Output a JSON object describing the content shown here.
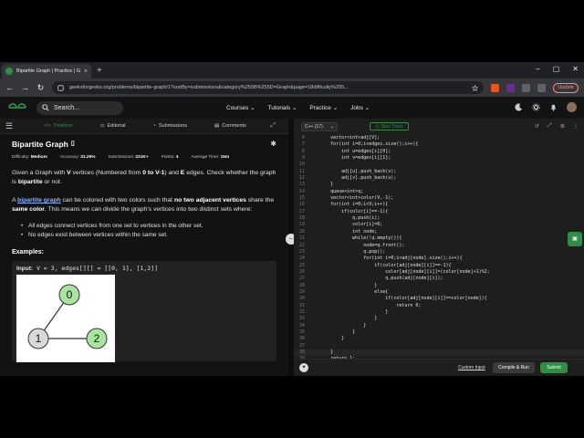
{
  "browser": {
    "tab_title": "Bipartite Graph | Practice | Geek",
    "tab_close": "×",
    "new_tab": "+",
    "url": "geeksforgeeks.org/problems/bipartite-graph/1?sortBy=submissions&category%255B%255D=Graph&page=18difficulty%255...",
    "update_label": "Update",
    "window_controls": [
      "–",
      "▢",
      "✕"
    ],
    "nav": [
      "←",
      "→",
      "↻"
    ]
  },
  "header": {
    "search_placeholder": "Search...",
    "menu": [
      "Courses ⌄",
      "Tutorials ⌄",
      "Practice ⌄",
      "Jobs ⌄"
    ]
  },
  "left_tabs": [
    {
      "icon": "</>",
      "label": "Problem"
    },
    {
      "icon": "▭",
      "label": "Editorial"
    },
    {
      "icon": "◔",
      "label": "Submissions"
    },
    {
      "icon": "▤",
      "label": "Comments"
    }
  ],
  "problem": {
    "title": "Bipartite Graph",
    "difficulty_label": "Difficulty:",
    "difficulty": "Medium",
    "accuracy_label": "Accuracy:",
    "accuracy": "31.25%",
    "submissions_label": "Submissions:",
    "submissions": "221K+",
    "points_label": "Points:",
    "points": "4",
    "avg_time_label": "Average Time:",
    "avg_time": "15m",
    "p1_a": "Given a Graph with ",
    "p1_b": "V",
    "p1_c": " vertices (Numbered from ",
    "p1_d": "0 to V-1",
    "p1_e": ") and ",
    "p1_f": "E",
    "p1_g": " edges. Check whether the graph is ",
    "p1_h": "bipartite",
    "p1_i": " or not.",
    "p2_a": "A ",
    "p2_link": "bipartite graph",
    "p2_b": " can be colored with two colors such that ",
    "p2_c": "no two adjacent vertices",
    "p2_d": " share the ",
    "p2_e": "same color",
    "p2_f": ". This means we can divide the graph's vertices into two distinct sets where:",
    "bullets": [
      "All edges connect vertices from one set to vertices in the other set.",
      "No edges exist between vertices within the same set."
    ],
    "examples_label": "Examples:",
    "example_input_label": "Input:",
    "example_input": " V = 3, edges[][] = [[0, 1], [1,2]]",
    "graph_nodes": [
      "0",
      "1",
      "2"
    ]
  },
  "editor": {
    "language": "C++ (17)",
    "timer_label": "Start Timer",
    "lines": [
      {
        "n": "6",
        "t": "        vector<int>adj[V];"
      },
      {
        "n": "7",
        "t": "        for(int i=0;i<edges.size();i++){"
      },
      {
        "n": "8",
        "t": "            int u=edges[i][0];"
      },
      {
        "n": "9",
        "t": "            int v=edges[i][1];"
      },
      {
        "n": "10",
        "t": ""
      },
      {
        "n": "11",
        "t": "            adj[u].push_back(v);"
      },
      {
        "n": "12",
        "t": "            adj[v].push_back(u);"
      },
      {
        "n": "13",
        "t": "        }"
      },
      {
        "n": "14",
        "t": "        queue<int>q;"
      },
      {
        "n": "15",
        "t": "        vector<int>color(V,-1);"
      },
      {
        "n": "16",
        "t": "        for(int i=0;i<V;i++){"
      },
      {
        "n": "17",
        "t": "            if(color[i]==-1){"
      },
      {
        "n": "18",
        "t": "                q.push(i);"
      },
      {
        "n": "19",
        "t": "                color[i]=0;"
      },
      {
        "n": "20",
        "t": "                int node;"
      },
      {
        "n": "21",
        "t": "                while(!q.empty()){"
      },
      {
        "n": "22",
        "t": "                    node=q.front();"
      },
      {
        "n": "23",
        "t": "                    q.pop();"
      },
      {
        "n": "24",
        "t": "                    for(int i=0;i<adj[node].size();i++){"
      },
      {
        "n": "25",
        "t": "                        if(color[adj[node][i]]==-1){"
      },
      {
        "n": "26",
        "t": "                            color[adj[node][i]]=(color[node]+1)%2;"
      },
      {
        "n": "27",
        "t": "                            q.push(adj[node][i]);"
      },
      {
        "n": "28",
        "t": "                        }"
      },
      {
        "n": "29",
        "t": "                        else{"
      },
      {
        "n": "30",
        "t": "                            if(color[adj[node][i]]==color[node]){"
      },
      {
        "n": "31",
        "t": "                                return 0;"
      },
      {
        "n": "32",
        "t": "                            }"
      },
      {
        "n": "33",
        "t": "                        }"
      },
      {
        "n": "34",
        "t": "                    }"
      },
      {
        "n": "35",
        "t": "                }"
      },
      {
        "n": "36",
        "t": "            }"
      },
      {
        "n": "37",
        "t": ""
      },
      {
        "n": "38",
        "t": "        }"
      },
      {
        "n": "39",
        "t": "        return 1;"
      },
      {
        "n": "40",
        "t": "    }"
      },
      {
        "n": "41",
        "t": "};"
      }
    ],
    "custom_input_label": "Custom Input",
    "compile_label": "Compile & Run",
    "submit_label": "Submit"
  }
}
